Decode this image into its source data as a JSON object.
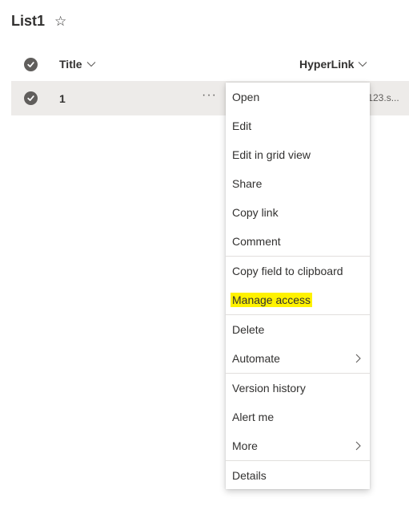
{
  "list": {
    "title": "List1"
  },
  "columns": {
    "title": "Title",
    "hyperlink": "HyperLink"
  },
  "rows": [
    {
      "title": "1",
      "more": "···",
      "hyperlink": "st123.s..."
    }
  ],
  "menu": {
    "items": [
      {
        "label": "Open"
      },
      {
        "label": "Edit"
      },
      {
        "label": "Edit in grid view"
      },
      {
        "label": "Share"
      },
      {
        "label": "Copy link"
      },
      {
        "label": "Comment"
      },
      {
        "label": "Copy field to clipboard"
      },
      {
        "label": "Manage access",
        "highlighted": true
      },
      {
        "label": "Delete"
      },
      {
        "label": "Automate",
        "submenu": true
      },
      {
        "label": "Version history"
      },
      {
        "label": "Alert me"
      },
      {
        "label": "More",
        "submenu": true
      },
      {
        "label": "Details"
      }
    ]
  },
  "colors": {
    "highlight": "#fff200",
    "row_selected": "#edebe9",
    "check": "#605e5c"
  },
  "icons": [
    "star-icon",
    "checkmark-icon",
    "chevron-down-icon",
    "more-icon",
    "chevron-right-icon"
  ]
}
